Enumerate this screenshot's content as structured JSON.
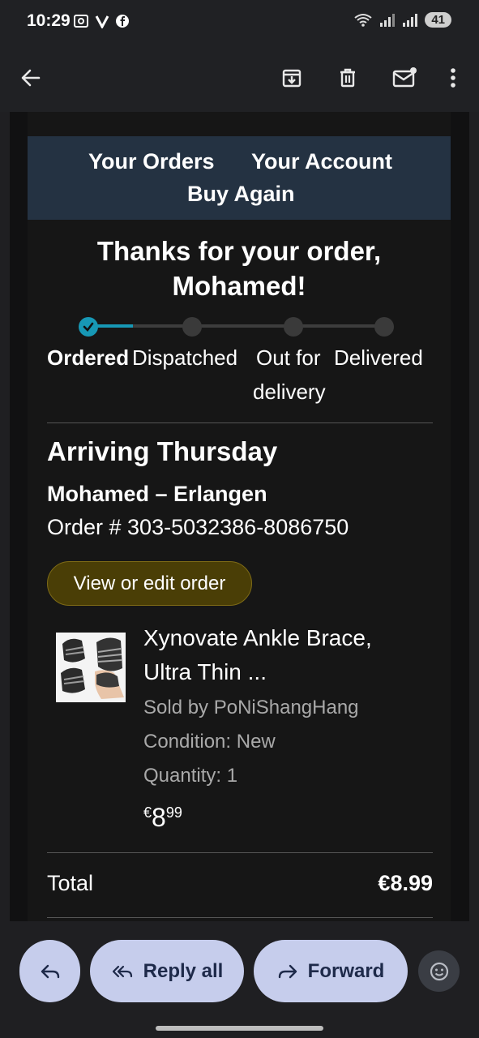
{
  "status_bar": {
    "time": "10:29",
    "left_icons": [
      "screenshot-icon",
      "v-app-icon",
      "facebook-icon"
    ],
    "battery": "41"
  },
  "app_bar": {
    "icons": [
      "back-arrow-icon",
      "archive-icon",
      "delete-icon",
      "mark-unread-icon",
      "more-vert-icon"
    ]
  },
  "email": {
    "nav": {
      "your_orders": "Your Orders",
      "your_account": "Your Account",
      "buy_again": "Buy Again"
    },
    "thanks_line1": "Thanks for your order,",
    "thanks_line2": "Mohamed!",
    "progress": {
      "current_step": 1,
      "steps": [
        {
          "label": "Ordered"
        },
        {
          "label": "Dispatched"
        },
        {
          "label": "Out for",
          "label2": "delivery"
        },
        {
          "label": "Delivered"
        }
      ]
    },
    "arriving": "Arriving Thursday",
    "recipient": "Mohamed – Erlangen",
    "order_number": "Order # 303-5032386-8086750",
    "view_edit_button": "View or edit order",
    "item": {
      "name_line1": "Xynovate Ankle Brace,",
      "name_line2": "Ultra Thin ...",
      "sold_by": "Sold by PoNiShangHang",
      "condition": "Condition: New",
      "quantity": "Quantity: 1",
      "price_currency": "€",
      "price_main": "8",
      "price_cents": "99"
    },
    "total_label": "Total",
    "total_value": "€8.99"
  },
  "actions": {
    "reply_icon": "reply-icon",
    "reply_all_label": "Reply all",
    "forward_label": "Forward",
    "emoji_icon": "emoji-reaction-icon"
  },
  "colors": {
    "banner": "#243242",
    "progress_accent": "#1798b5",
    "view_button": "#4a3e06",
    "action_pill": "#c6cdec"
  }
}
